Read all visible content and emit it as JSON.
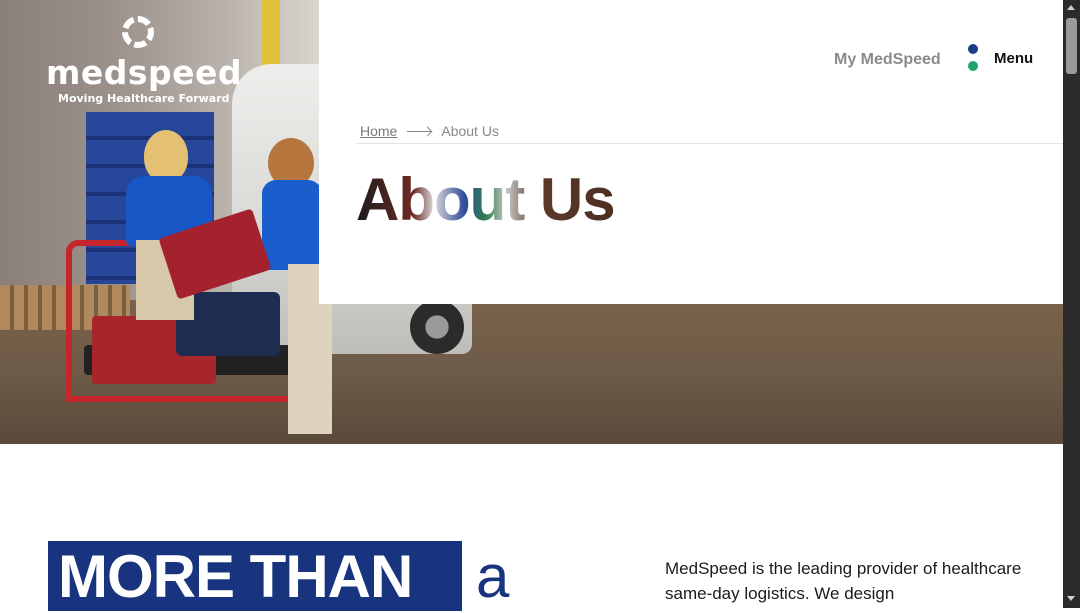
{
  "logo": {
    "wordmark": "medspeed",
    "tagline": "Moving Healthcare Forward"
  },
  "header": {
    "my_link": "My MedSpeed",
    "menu_label": "Menu"
  },
  "breadcrumb": {
    "home": "Home",
    "current": "About Us"
  },
  "page": {
    "title": "About Us"
  },
  "section": {
    "heading_strong": "MORE THAN",
    "heading_rest": "a",
    "intro_text": "MedSpeed is the leading provider of healthcare same-day logistics. We design"
  },
  "colors": {
    "brand_blue": "#19347f",
    "brand_green": "#1ea36b",
    "muted_text": "#8a8a8a"
  }
}
